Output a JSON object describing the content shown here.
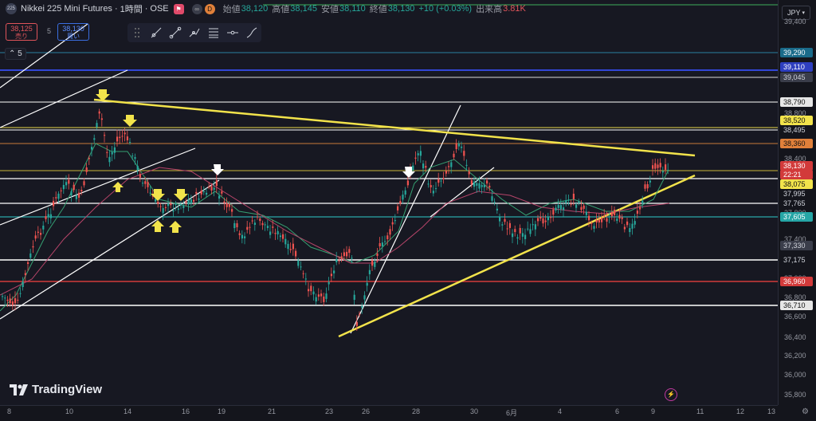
{
  "header": {
    "symbol": "Nikkei 225 Mini Futures",
    "interval": "1時間",
    "exchange": "OSE",
    "logo_text": "225",
    "badge_d": "D",
    "open_label": "始値",
    "open": "38,120",
    "high_label": "高値",
    "high": "38,145",
    "low_label": "安値",
    "low": "38,110",
    "close_label": "終値",
    "close": "38,130",
    "change": "+10 (+0.03%)",
    "volume_label": "出来高",
    "volume": "3.81K"
  },
  "trade": {
    "sell_price": "38,125",
    "sell_label": "売り",
    "spread": "5",
    "buy_price": "38,130",
    "buy_label": "買い"
  },
  "toolbar": {
    "tools": [
      "ray-line-icon",
      "trend-line-icon",
      "path-icon",
      "fib-lines-icon",
      "horizontal-line-icon",
      "brush-icon"
    ]
  },
  "indicator": {
    "value": "5"
  },
  "currency": "JPY",
  "brand": "TradingView",
  "price_ticks": [
    "39,400",
    "38,800",
    "38,400",
    "38,200",
    "38,000",
    "37,800",
    "37,400",
    "37,000",
    "36,800",
    "36,600",
    "36,400",
    "36,200",
    "36,000",
    "35,800"
  ],
  "price_labels": [
    {
      "text": "39,290",
      "bg": "#1a6b8a",
      "fg": "#ffffff"
    },
    {
      "text": "39,110",
      "bg": "#2e3fbf",
      "fg": "#ffffff"
    },
    {
      "text": "39,045",
      "bg": "#3a3d4a",
      "fg": "#d1d4dc"
    },
    {
      "text": "38,790",
      "bg": "#e6e6e6",
      "fg": "#111111"
    },
    {
      "text": "38,520",
      "bg": "#f2e34b",
      "fg": "#111111"
    },
    {
      "text": "38,495",
      "bg": "#14151c",
      "fg": "#d1d4dc"
    },
    {
      "text": "38,360",
      "bg": "#e0803a",
      "fg": "#111111"
    },
    {
      "text": "38,130",
      "bg": "#d23a3a",
      "fg": "#ffffff"
    },
    {
      "text": "22:21",
      "bg": "#d23a3a",
      "fg": "#ffffff"
    },
    {
      "text": "38,075",
      "bg": "#f2e34b",
      "fg": "#111111"
    },
    {
      "text": "37,995",
      "bg": "#14151c",
      "fg": "#d1d4dc"
    },
    {
      "text": "37,765",
      "bg": "#14151c",
      "fg": "#d1d4dc"
    },
    {
      "text": "37,605",
      "bg": "#26a6a6",
      "fg": "#ffffff"
    },
    {
      "text": "37,330",
      "bg": "#3a3d4a",
      "fg": "#d1d4dc"
    },
    {
      "text": "37,175",
      "bg": "#14151c",
      "fg": "#d1d4dc"
    },
    {
      "text": "36,960",
      "bg": "#d23a3a",
      "fg": "#ffffff"
    },
    {
      "text": "36,710",
      "bg": "#e6e6e6",
      "fg": "#111111"
    }
  ],
  "time_ticks": [
    "8",
    "10",
    "14",
    "16",
    "19",
    "21",
    "23",
    "26",
    "28",
    "30",
    "6月",
    "4",
    "6",
    "9",
    "11",
    "12",
    "13"
  ]
}
